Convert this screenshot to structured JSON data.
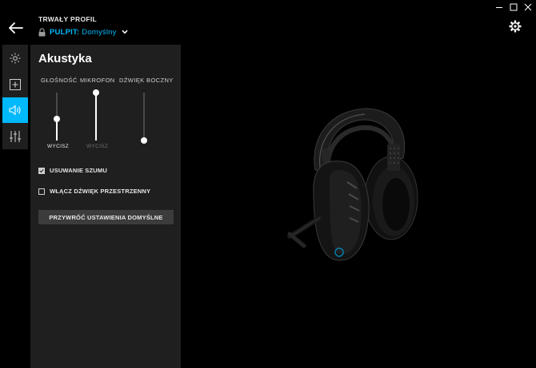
{
  "header": {
    "profile_label": "TRWAŁY PROFIL",
    "profile_key": "PULPIT:",
    "profile_value": "Domyślny"
  },
  "sidebar": {
    "items": [
      {
        "name": "lighting",
        "icon": "sun-icon",
        "active": false
      },
      {
        "name": "assignments",
        "icon": "plus-square-icon",
        "active": false
      },
      {
        "name": "acoustics",
        "icon": "speaker-icon",
        "active": true
      },
      {
        "name": "equalizer",
        "icon": "sliders-icon",
        "active": false
      }
    ]
  },
  "panel": {
    "title": "Akustyka",
    "sliders": [
      {
        "label": "GŁOŚNOŚĆ",
        "mute_label": "WYCISZ",
        "mute_active": true,
        "level": 0.45
      },
      {
        "label": "MIKROFON",
        "mute_label": "WYCISZ",
        "mute_active": false,
        "level": 1.0
      },
      {
        "label": "DŹWIĘK BOCZNY",
        "mute_label": "",
        "mute_active": false,
        "level": 0.0
      }
    ],
    "options": [
      {
        "label": "USUWANIE SZUMU",
        "checked": true
      },
      {
        "label": "WŁĄCZ DŹWIĘK PRZESTRZENNY",
        "checked": false
      }
    ],
    "reset_label": "PRZYWRÓĆ USTAWIENIA DOMYŚLNE"
  },
  "colors": {
    "accent": "#00b8fc",
    "panel": "#1f1f1f",
    "background": "#000000"
  }
}
